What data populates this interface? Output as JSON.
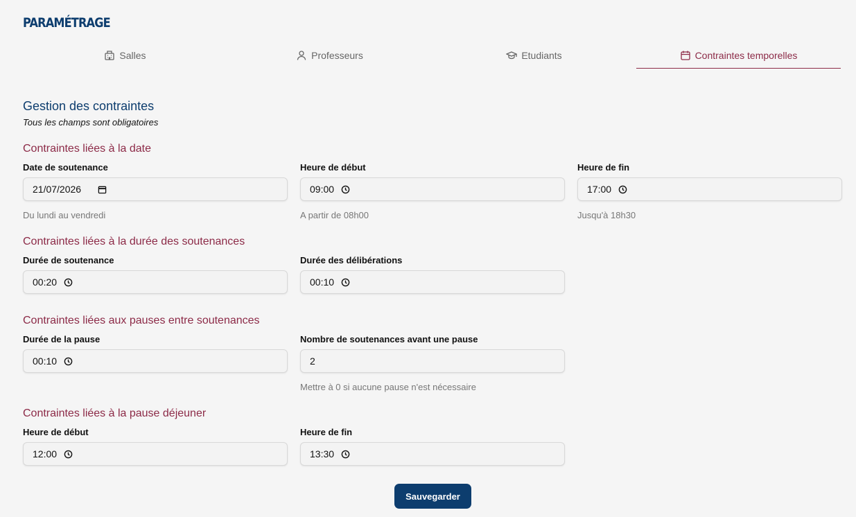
{
  "app": {
    "title": "PARAMÉTRAGE"
  },
  "tabs": [
    {
      "label": "Salles",
      "icon": "building-icon"
    },
    {
      "label": "Professeurs",
      "icon": "user-icon"
    },
    {
      "label": "Etudiants",
      "icon": "graduation-cap-icon"
    },
    {
      "label": "Contraintes temporelles",
      "icon": "calendar-icon",
      "active": true
    }
  ],
  "page": {
    "heading": "Gestion des contraintes",
    "note": "Tous les champs sont obligatoires"
  },
  "sections": {
    "date": {
      "title": "Contraintes liées à la date",
      "date_label": "Date de soutenance",
      "date_value": "21/07/2026",
      "date_help": "Du lundi au vendredi",
      "start_label": "Heure de début",
      "start_value": "09:00",
      "start_help": "A partir de 08h00",
      "end_label": "Heure de fin",
      "end_value": "17:00",
      "end_help": "Jusqu'à 18h30"
    },
    "duration": {
      "title": "Contraintes liées à la durée des soutenances",
      "defense_label": "Durée de soutenance",
      "defense_value": "00:20",
      "delib_label": "Durée des délibérations",
      "delib_value": "00:10"
    },
    "breaks": {
      "title": "Contraintes liées aux pauses entre soutenances",
      "pause_label": "Durée de la pause",
      "pause_value": "00:10",
      "count_label": "Nombre de soutenances avant une pause",
      "count_value": "2",
      "count_help": "Mettre à 0 si aucune pause n'est nécessaire"
    },
    "lunch": {
      "title": "Contraintes liées à la pause déjeuner",
      "start_label": "Heure de début",
      "start_value": "12:00",
      "end_label": "Heure de fin",
      "end_value": "13:30"
    }
  },
  "actions": {
    "save_label": "Sauvegarder"
  },
  "colors": {
    "primary": "#0d3d6e",
    "accent": "#8c2a47",
    "background": "#f5f5f5"
  }
}
